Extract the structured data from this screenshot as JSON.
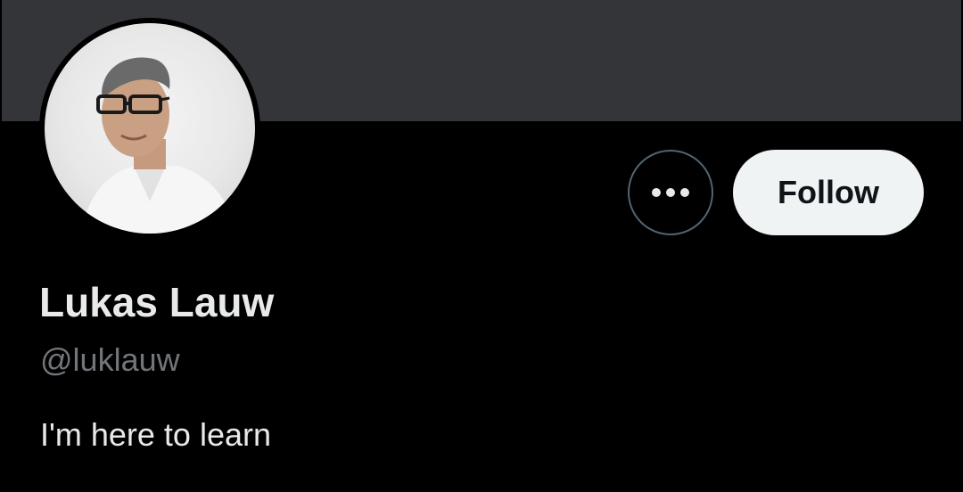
{
  "profile": {
    "display_name": "Lukas Lauw",
    "handle": "@luklauw",
    "bio": "I'm here to learn",
    "avatar_icon": "profile-photo"
  },
  "actions": {
    "more_icon": "more-horizontal-icon",
    "follow_label": "Follow"
  },
  "colors": {
    "background": "#000000",
    "banner": "#333539",
    "primary_text": "#e7e9ea",
    "secondary_text": "#71767b",
    "follow_bg": "#eff3f4",
    "follow_text": "#0f1419",
    "outline": "#536471"
  }
}
